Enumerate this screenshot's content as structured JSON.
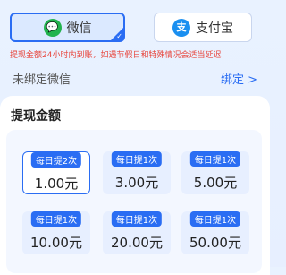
{
  "payment_methods": [
    {
      "name": "微信",
      "icon": "wechat-icon",
      "selected": true
    },
    {
      "name": "支付宝",
      "icon": "alipay-icon",
      "selected": false
    }
  ],
  "notice": "提现金额24小时内到账，如遇节假日和特殊情况会适当延迟",
  "bind": {
    "status": "未绑定微信",
    "link": "绑定 >"
  },
  "withdraw": {
    "title": "提现金额",
    "options": [
      {
        "badge": "每日提2次",
        "amount": "1.00元",
        "selected": true
      },
      {
        "badge": "每日提1次",
        "amount": "3.00元",
        "selected": false
      },
      {
        "badge": "每日提1次",
        "amount": "5.00元",
        "selected": false
      },
      {
        "badge": "每日提1次",
        "amount": "10.00元",
        "selected": false
      },
      {
        "badge": "每日提1次",
        "amount": "20.00元",
        "selected": false
      },
      {
        "badge": "每日提1次",
        "amount": "50.00元",
        "selected": false
      }
    ]
  },
  "colors": {
    "accent": "#2a6df3",
    "notice": "#e8453c",
    "wechat": "#22b34e",
    "alipay": "#1a8ff0"
  }
}
